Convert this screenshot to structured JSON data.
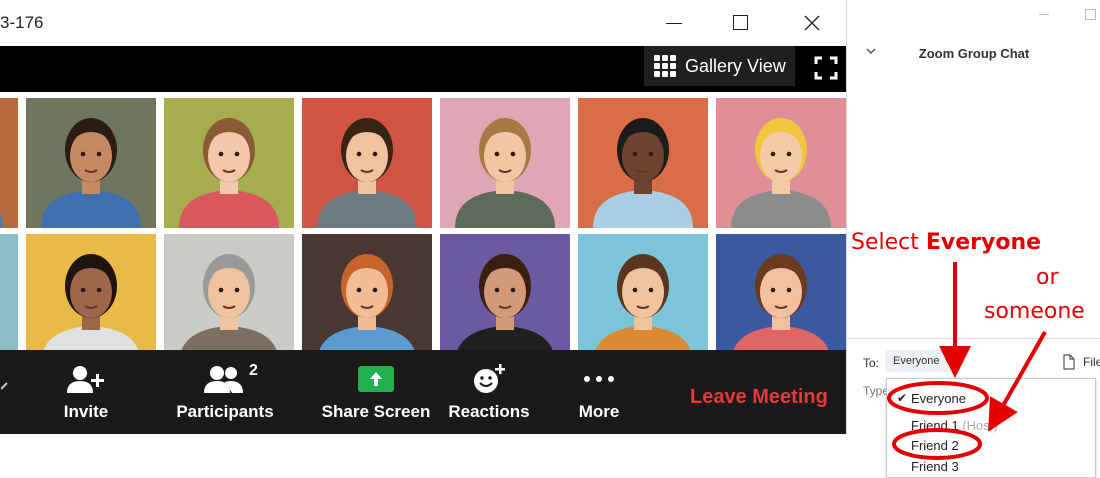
{
  "window": {
    "title": "3-176",
    "gallery_view_label": "Gallery View"
  },
  "toolbar": {
    "invite_label": "Invite",
    "participants_label": "Participants",
    "participants_count": "2",
    "share_screen_label": "Share Screen",
    "reactions_label": "Reactions",
    "more_label": "More",
    "leave_label": "Leave Meeting"
  },
  "gallery": {
    "tiles": [
      {
        "bg": "#b86a3c",
        "skin": "#f2c5a0",
        "hair": "#6b3a20",
        "shirt": "#4c79b4"
      },
      {
        "bg": "#6e7660",
        "skin": "#c58a63",
        "hair": "#2c1c12",
        "shirt": "#3f6fb0"
      },
      {
        "bg": "#a5ad4f",
        "skin": "#f3c7a9",
        "hair": "#8a5a36",
        "shirt": "#d9595c"
      },
      {
        "bg": "#d05444",
        "skin": "#f0c29d",
        "hair": "#3a2414",
        "shirt": "#6d7a7d"
      },
      {
        "bg": "#dfa6b3",
        "skin": "#f2c6a2",
        "hair": "#a77a44",
        "shirt": "#5d6b5a"
      },
      {
        "bg": "#d86d47",
        "skin": "#6e4330",
        "hair": "#1c1c1c",
        "shirt": "#a8cfe3"
      },
      {
        "bg": "#de8f98",
        "skin": "#f3c9a8",
        "hair": "#f0c63d",
        "shirt": "#8c8c8c"
      },
      {
        "bg": "#8bbfc5",
        "skin": "#f2c5a0",
        "hair": "#5a3822",
        "shirt": "#4c79b4"
      },
      {
        "bg": "#e8ba48",
        "skin": "#a0664a",
        "hair": "#1e1410",
        "shirt": "#e0e0e0"
      },
      {
        "bg": "#c9cbc5",
        "skin": "#f0c29d",
        "hair": "#9a9a9a",
        "shirt": "#7c6f60"
      },
      {
        "bg": "#4a3632",
        "skin": "#f2bc94",
        "hair": "#c5642b",
        "shirt": "#5c9bd1"
      },
      {
        "bg": "#6c5aa0",
        "skin": "#d29a7a",
        "hair": "#3a1f12",
        "shirt": "#202020"
      },
      {
        "bg": "#7cc4d8",
        "skin": "#f0c29d",
        "hair": "#5a3620",
        "shirt": "#d98a33"
      },
      {
        "bg": "#3b59a0",
        "skin": "#f2c0a0",
        "hair": "#6a3b1e",
        "shirt": "#e06666"
      }
    ]
  },
  "chat": {
    "title": "Zoom Group Chat",
    "to_label": "To:",
    "to_value": "Everyone",
    "file_label": "File",
    "type_placeholder": "Type",
    "dropdown": {
      "items": [
        "Everyone",
        "Friend 1",
        "Friend 2",
        "Friend 3"
      ],
      "host_tag": "(Host)",
      "selected": "Everyone"
    }
  },
  "annotations": {
    "select_prefix": "Select ",
    "select_bold": "Everyone",
    "or": "or",
    "someone": "someone",
    "color": "#e20000"
  }
}
